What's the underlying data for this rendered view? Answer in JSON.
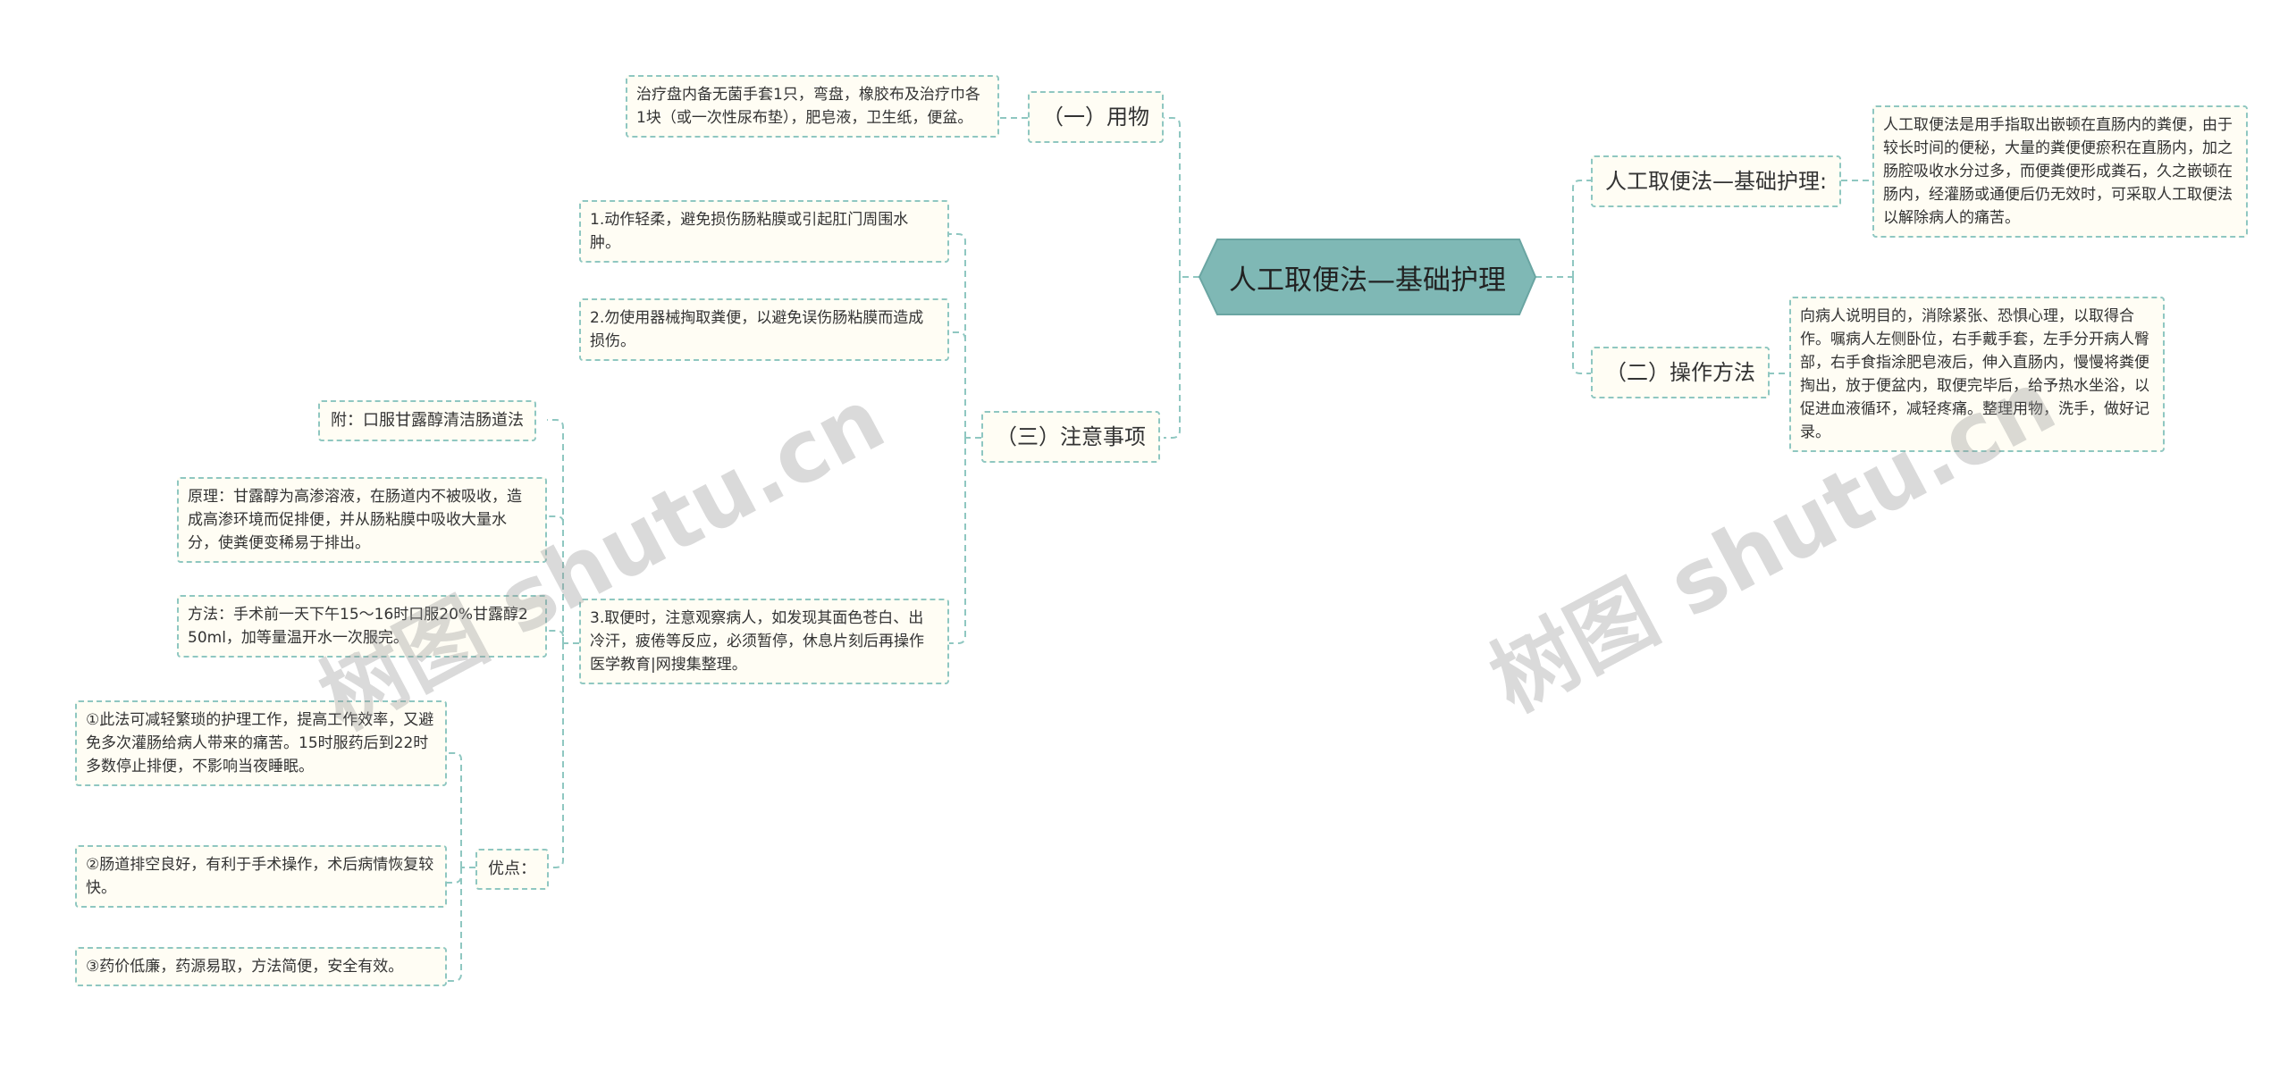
{
  "root": {
    "label": "人工取便法—基础护理"
  },
  "right": {
    "definition_label": "人工取便法—基础护理:",
    "definition_text": "人工取便法是用手指取出嵌顿在直肠内的粪便，由于较长时间的便秘，大量的粪便便瘀积在直肠内，加之肠腔吸收水分过多，而便粪便形成粪石，久之嵌顿在肠内，经灌肠或通便后仍无效时，可采取人工取便法以解除病人的痛苦。",
    "operation_label": "（二）操作方法",
    "operation_text": "向病人说明目的，消除紧张、恐惧心理，以取得合作。嘱病人左侧卧位，右手戴手套，左手分开病人臀部，右手食指涂肥皂液后，伸入直肠内，慢慢将粪便掏出，放于便盆内，取便完毕后，给予热水坐浴，以促进血液循环，减轻疼痛。整理用物，洗手，做好记录。"
  },
  "left": {
    "supplies_label": "（一）用物",
    "supplies_text": "治疗盘内备无菌手套1只，弯盘，橡胶布及治疗巾各1块（或一次性尿布垫），肥皂液，卫生纸，便盆。",
    "cautions_label": "（三）注意事项",
    "caution_1": "1.动作轻柔，避免损伤肠粘膜或引起肛门周围水肿。",
    "caution_2": "2.勿使用器械掏取粪便，以避免误伤肠粘膜而造成损伤。",
    "caution_3": "3.取便时，注意观察病人，如发现其面色苍白、出冷汗，疲倦等反应，必须暂停，休息片刻后再操作医学教育|网搜集整理。",
    "appendix_label": "附：口服甘露醇清洁肠道法",
    "principle": "原理：甘露醇为高渗溶液，在肠道内不被吸收，造成高渗环境而促排便，并从肠粘膜中吸收大量水分，使粪便变稀易于排出。",
    "method": "方法：手术前一天下午15～16时口服20%甘露醇250ml，加等量温开水一次服完。",
    "advantages_label": "优点：",
    "adv_1": "①此法可减轻繁琐的护理工作，提高工作效率，又避免多次灌肠给病人带来的痛苦。15时服药后到22时多数停止排便，不影响当夜睡眠。",
    "adv_2": "②肠道排空良好，有利于手术操作，术后病情恢复较快。",
    "adv_3": "③药价低廉，药源易取，方法简便，安全有效。"
  },
  "watermarks": [
    "树图 shutu.cn",
    "树图 shutu.cn"
  ],
  "colors": {
    "root_fill": "#7fb8b5",
    "line": "#8fc7c1",
    "node_bg": "#fffdf4"
  }
}
